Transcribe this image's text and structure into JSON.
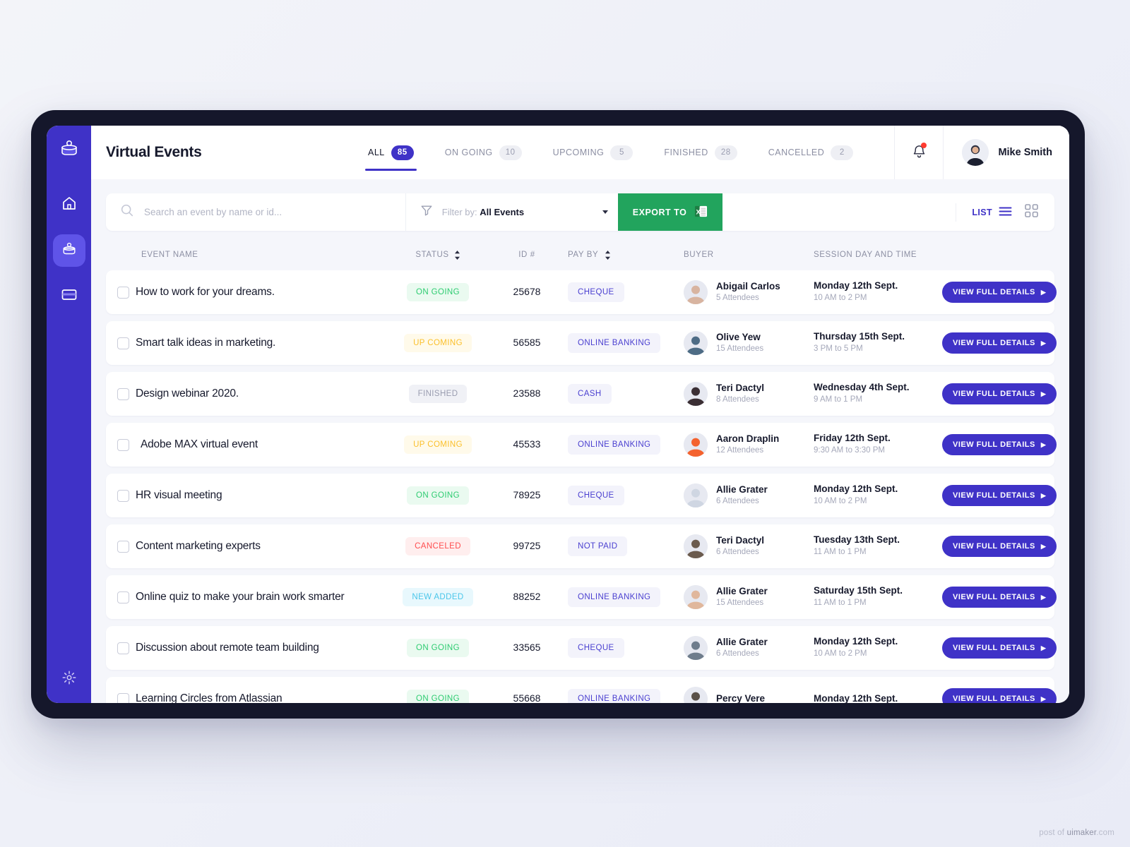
{
  "app": {
    "page_title": "Virtual Events",
    "accent_color": "#3f32c7",
    "sidebar_color": "#3f32c7",
    "export_color": "#22a45d"
  },
  "sidebar": {
    "logo_icon": "podium-logo-icon",
    "items": [
      {
        "icon": "home-icon",
        "name": "sidebar-item-home",
        "active": false
      },
      {
        "icon": "events-icon",
        "name": "sidebar-item-events",
        "active": true
      },
      {
        "icon": "card-icon",
        "name": "sidebar-item-billing",
        "active": false
      }
    ],
    "footer_item": {
      "icon": "gear-icon",
      "name": "sidebar-item-settings"
    }
  },
  "header": {
    "tabs": [
      {
        "label": "ALL",
        "count": "85",
        "active": true
      },
      {
        "label": "ON GOING",
        "count": "10",
        "active": false
      },
      {
        "label": "UPCOMING",
        "count": "5",
        "active": false
      },
      {
        "label": "FINISHED",
        "count": "28",
        "active": false
      },
      {
        "label": "CANCELLED",
        "count": "2",
        "active": false
      }
    ],
    "notification_icon": "bell-icon",
    "has_notification_dot": true,
    "user_name": "Mike Smith"
  },
  "toolbar": {
    "search_placeholder": "Search an event by name or id...",
    "search_value": "",
    "search_icon": "search-icon",
    "filter_icon": "filter-icon",
    "filter_label": "Filter by:",
    "filter_value": "All Events",
    "export_label": "EXPORT TO",
    "export_icon": "excel-icon",
    "list_label": "LIST",
    "list_icon": "list-icon",
    "grid_icon": "grid-icon"
  },
  "table": {
    "columns": [
      {
        "label": "EVENT NAME",
        "sortable": false
      },
      {
        "label": "STATUS",
        "sortable": true
      },
      {
        "label": "ID #",
        "sortable": false
      },
      {
        "label": "PAY BY",
        "sortable": true
      },
      {
        "label": "BUYER",
        "sortable": false
      },
      {
        "label": "SESSION DAY AND TIME",
        "sortable": false
      }
    ],
    "action_label": "VIEW FULL DETAILS",
    "rows": [
      {
        "name": "How to work for your dreams.",
        "status": "ON GOING",
        "status_kind": "ongoing",
        "id": "25678",
        "pay_by": "CHEQUE",
        "buyer": "Abigail Carlos",
        "attendees": "5 Attendees",
        "avatar_color": "#d8b4a0",
        "session_day": "Monday 12th Sept.",
        "session_time": "10 AM to 2 PM",
        "indent": false
      },
      {
        "name": "Smart talk ideas in marketing.",
        "status": "UP COMING",
        "status_kind": "upcoming",
        "id": "56585",
        "pay_by": "ONLINE BANKING",
        "buyer": "Olive Yew",
        "attendees": "15 Attendees",
        "avatar_color": "#4e6c85",
        "session_day": "Thursday 15th Sept.",
        "session_time": "3 PM to 5 PM",
        "indent": false
      },
      {
        "name": "Design webinar 2020.",
        "status": "FINISHED",
        "status_kind": "finished",
        "id": "23588",
        "pay_by": "CASH",
        "buyer": "Teri Dactyl",
        "attendees": "8 Attendees",
        "avatar_color": "#3b2f34",
        "session_day": "Wednesday 4th Sept.",
        "session_time": "9 AM to 1 PM",
        "indent": false
      },
      {
        "name": "Adobe MAX virtual event",
        "status": "UP COMING",
        "status_kind": "upcoming",
        "id": "45533",
        "pay_by": "ONLINE BANKING",
        "buyer": "Aaron Draplin",
        "attendees": "12 Attendees",
        "avatar_color": "#f4622e",
        "session_day": "Friday 12th Sept.",
        "session_time": "9:30 AM to 3:30 PM",
        "indent": true
      },
      {
        "name": "HR visual meeting",
        "status": "ON GOING",
        "status_kind": "ongoing",
        "id": "78925",
        "pay_by": "CHEQUE",
        "buyer": "Allie Grater",
        "attendees": "6 Attendees",
        "avatar_color": "#cfd6e2",
        "session_day": "Monday 12th Sept.",
        "session_time": "10 AM to 2 PM",
        "indent": false
      },
      {
        "name": "Content marketing experts",
        "status": "CANCELED",
        "status_kind": "canceled",
        "id": "99725",
        "pay_by": "NOT PAID",
        "buyer": "Teri Dactyl",
        "attendees": "6 Attendees",
        "avatar_color": "#6b5b4e",
        "session_day": "Tuesday 13th Sept.",
        "session_time": "11 AM to 1 PM",
        "indent": false
      },
      {
        "name": "Online quiz to make your brain work smarter",
        "status": "NEW ADDED",
        "status_kind": "newadded",
        "id": "88252",
        "pay_by": "ONLINE BANKING",
        "buyer": "Allie Grater",
        "attendees": "15 Attendees",
        "avatar_color": "#e0b79c",
        "session_day": "Saturday 15th Sept.",
        "session_time": "11 AM to 1 PM",
        "indent": false
      },
      {
        "name": "Discussion about remote team building",
        "status": "ON GOING",
        "status_kind": "ongoing",
        "id": "33565",
        "pay_by": "CHEQUE",
        "buyer": "Allie Grater",
        "attendees": "6 Attendees",
        "avatar_color": "#6f7d8c",
        "session_day": "Monday 12th Sept.",
        "session_time": "10 AM to 2 PM",
        "indent": false
      },
      {
        "name": "Learning Circles from Atlassian",
        "status": "ON GOING",
        "status_kind": "ongoing",
        "id": "55668",
        "pay_by": "ONLINE BANKING",
        "buyer": "Percy Vere",
        "attendees": "",
        "avatar_color": "#5a5148",
        "session_day": "Monday 12th Sept.",
        "session_time": "",
        "indent": false
      }
    ]
  },
  "watermark": {
    "prefix": "post of",
    "site": "uimaker",
    "suffix": ".com"
  }
}
